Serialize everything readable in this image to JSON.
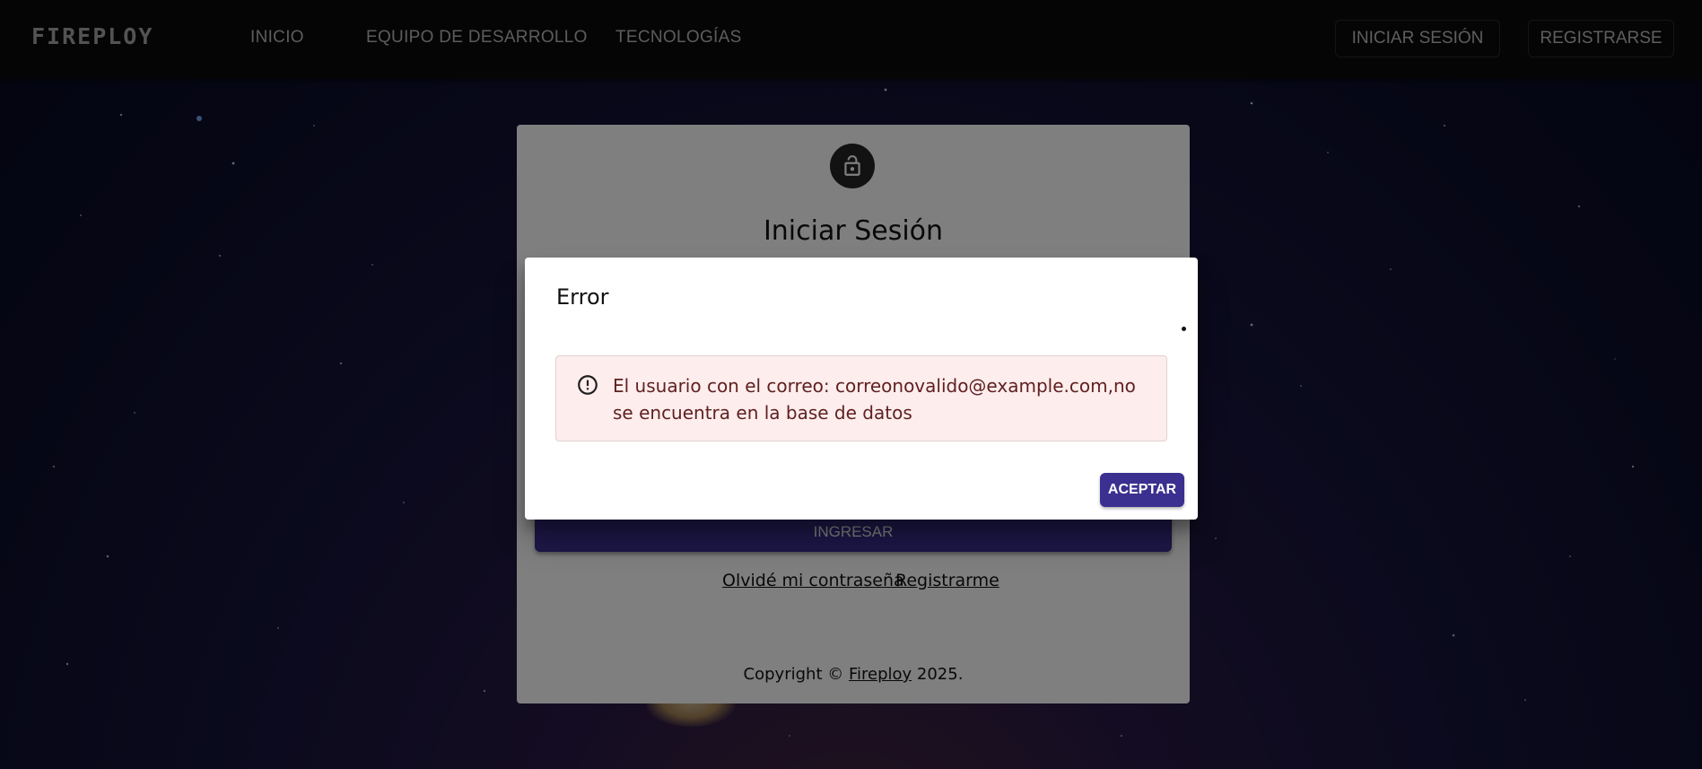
{
  "navbar": {
    "brand": "FIREPLOY",
    "links": [
      "INICIO",
      "EQUIPO DE DESARROLLO",
      "TECNOLOGÍAS"
    ],
    "login_button": "INICIAR SESIÓN",
    "register_button": "REGISTRARSE"
  },
  "login_card": {
    "title": "Iniciar Sesión",
    "submit_button": "INGRESAR",
    "forgot_password_link": "Olvidé mi contraseña",
    "register_link": "Registrarme",
    "copyright_prefix": "Copyright © ",
    "copyright_brand": "Fireploy",
    "copyright_suffix": " 2025."
  },
  "dialog": {
    "title": "Error",
    "alert_message": "El usuario con el correo: correonovalido@example.com,no se encuentra en la base de datos",
    "accept_button": "ACEPTAR"
  },
  "colors": {
    "primary": "#3b2f8f",
    "alert_background": "#fdeded",
    "alert_text": "#5f2120",
    "navbar": "#0b0b0c"
  },
  "icons": {
    "lock": "lock-open-icon",
    "alert": "error-outline-icon"
  }
}
